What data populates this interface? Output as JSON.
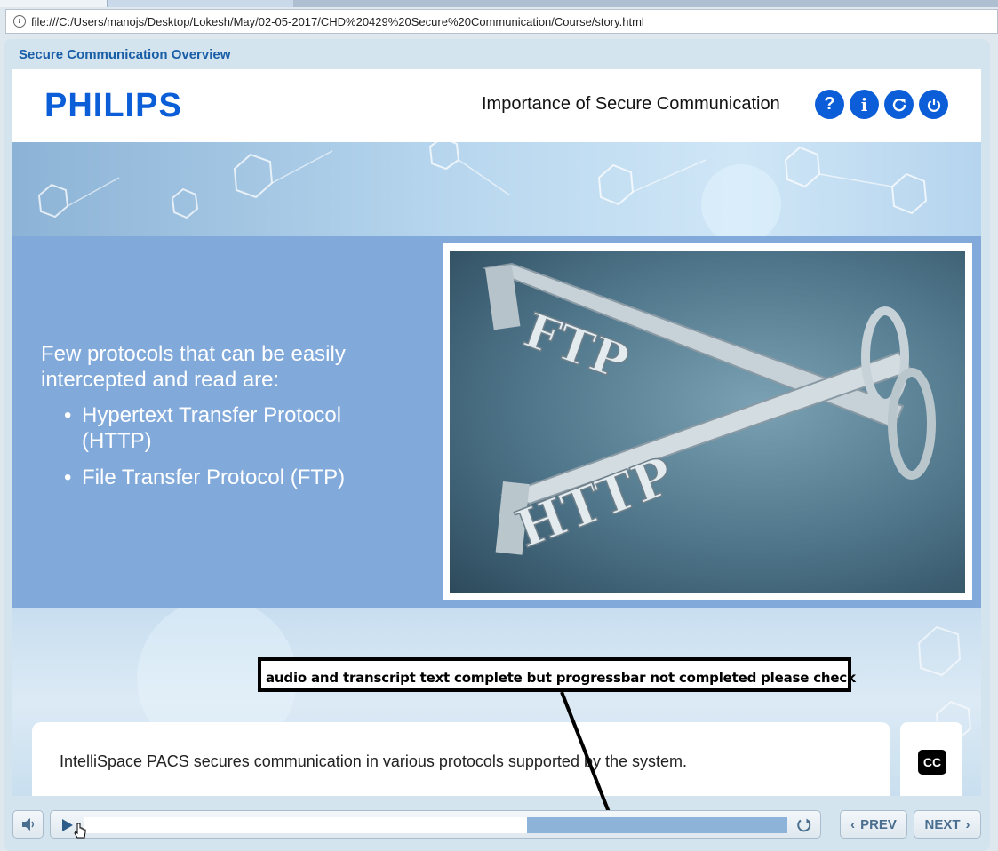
{
  "browser": {
    "url": "file:///C:/Users/manojs/Desktop/Lokesh/May/02-05-2017/CHD%20429%20Secure%20Communication/Course/story.html"
  },
  "player": {
    "course_title": "Secure Communication Overview"
  },
  "header": {
    "logo_text": "PHILIPS",
    "title": "Importance of Secure Communication",
    "buttons": [
      {
        "label": "?",
        "icon": "help-icon"
      },
      {
        "label": "i",
        "icon": "info-icon"
      },
      {
        "label": "",
        "icon": "refresh-icon"
      },
      {
        "label": "",
        "icon": "power-icon"
      }
    ]
  },
  "slide": {
    "intro": "Few protocols that can be easily intercepted and read are:",
    "bullets": [
      "Hypertext Transfer Protocol (HTTP)",
      "File Transfer Protocol (FTP)"
    ],
    "image_labels": [
      "FTP",
      "HTTP"
    ]
  },
  "transcript": {
    "text": "IntelliSpace PACS secures communication in various protocols supported by the system.",
    "cc_label": "CC"
  },
  "annotation": {
    "text": "audio and transcript text complete but progressbar not completed  please check"
  },
  "controls": {
    "progress": 0.63,
    "prev_label": "PREV",
    "next_label": "NEXT"
  },
  "colors": {
    "accent": "#0b5ed7",
    "course_title": "#1a5ea8",
    "content_band": "#81a9da"
  }
}
